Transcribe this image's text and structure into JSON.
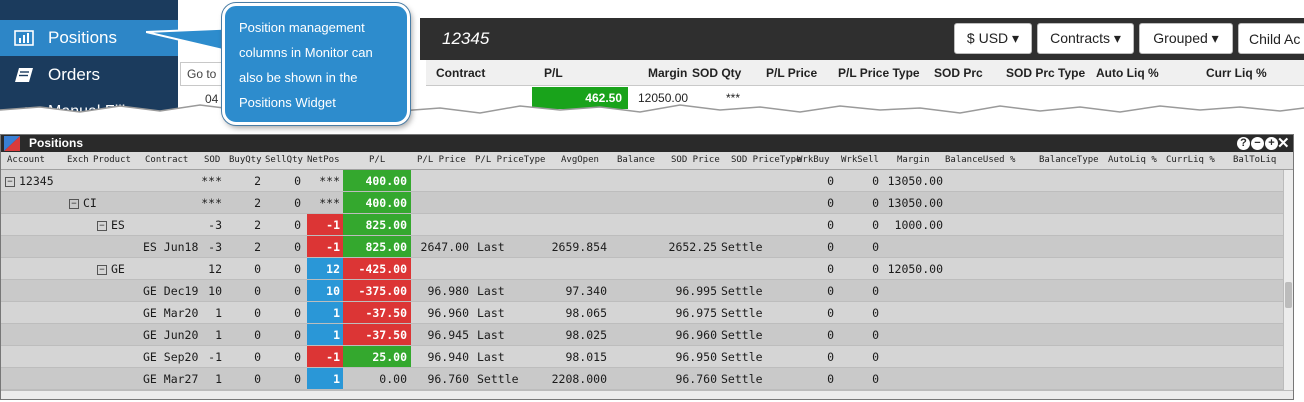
{
  "monitor": {
    "sidebar": {
      "items": [
        {
          "label": "Positions",
          "icon": "bar-chart-icon"
        },
        {
          "label": "Orders",
          "icon": "orders-icon"
        },
        {
          "label": "Manual Fills",
          "icon": "manual-fills-icon"
        }
      ]
    },
    "collapse_glyph": "«",
    "goto_placeholder": "Go to",
    "small_value": "04",
    "account_title": "12345",
    "buttons": [
      "$ USD ▾",
      "Contracts ▾",
      "Grouped ▾",
      "Child Ac"
    ],
    "grid_headers": [
      "Contract",
      "P/L",
      "Margin",
      "SOD Qty",
      "P/L Price",
      "P/L Price Type",
      "SOD Prc",
      "SOD Prc Type",
      "Auto Liq %",
      "Curr Liq %"
    ],
    "grid_row": {
      "pl": "462.50",
      "margin": "12050.00",
      "sod_qty": "***"
    }
  },
  "callout": {
    "text": "Position management columns in Monitor can also be shown in the Positions Widget"
  },
  "widget": {
    "title": "Positions",
    "controls": [
      "?",
      "−",
      "+",
      "✕"
    ],
    "columns": [
      "Account",
      "Exch",
      "Product",
      "Contract",
      "SOD",
      "BuyQty",
      "SellQty",
      "NetPos",
      "P/L",
      "P/L Price",
      "P/L PriceType",
      "AvgOpen",
      "Balance",
      "SOD Price",
      "SOD PriceType",
      "WrkBuy",
      "WrkSell",
      "Margin",
      "BalanceUsed %",
      "BalanceType",
      "AutoLiq %",
      "CurrLiq %",
      "BalToLiq"
    ],
    "colors": {
      "positive": "#34a82e",
      "negative": "#dc3535",
      "long": "#2a97d7"
    },
    "rows": [
      {
        "level": 0,
        "tree": "12345",
        "contract": "",
        "sod": "***",
        "buy": "2",
        "sell": "0",
        "net": "***",
        "net_color": "",
        "pl": "400.00",
        "pl_color": "positive",
        "pl_price": "",
        "pl_type": "",
        "avg_open": "",
        "sod_price": "",
        "sod_type": "",
        "wrk_buy": "0",
        "wrk_sell": "0",
        "margin": "13050.00"
      },
      {
        "level": 1,
        "tree": "CI",
        "contract": "",
        "sod": "***",
        "buy": "2",
        "sell": "0",
        "net": "***",
        "net_color": "",
        "pl": "400.00",
        "pl_color": "positive",
        "pl_price": "",
        "pl_type": "",
        "avg_open": "",
        "sod_price": "",
        "sod_type": "",
        "wrk_buy": "0",
        "wrk_sell": "0",
        "margin": "13050.00"
      },
      {
        "level": 2,
        "tree": "ES",
        "contract": "",
        "sod": "-3",
        "buy": "2",
        "sell": "0",
        "net": "-1",
        "net_color": "negative",
        "pl": "825.00",
        "pl_color": "positive",
        "pl_price": "",
        "pl_type": "",
        "avg_open": "",
        "sod_price": "",
        "sod_type": "",
        "wrk_buy": "0",
        "wrk_sell": "0",
        "margin": "1000.00"
      },
      {
        "level": 3,
        "tree": "",
        "contract": "ES Jun18",
        "sod": "-3",
        "buy": "2",
        "sell": "0",
        "net": "-1",
        "net_color": "negative",
        "pl": "825.00",
        "pl_color": "positive",
        "pl_price": "2647.00",
        "pl_type": "Last",
        "avg_open": "2659.854",
        "sod_price": "2652.25",
        "sod_type": "Settle",
        "wrk_buy": "0",
        "wrk_sell": "0",
        "margin": ""
      },
      {
        "level": 2,
        "tree": "GE",
        "contract": "",
        "sod": "12",
        "buy": "0",
        "sell": "0",
        "net": "12",
        "net_color": "long",
        "pl": "-425.00",
        "pl_color": "negative",
        "pl_price": "",
        "pl_type": "",
        "avg_open": "",
        "sod_price": "",
        "sod_type": "",
        "wrk_buy": "0",
        "wrk_sell": "0",
        "margin": "12050.00"
      },
      {
        "level": 3,
        "tree": "",
        "contract": "GE Dec19",
        "sod": "10",
        "buy": "0",
        "sell": "0",
        "net": "10",
        "net_color": "long",
        "pl": "-375.00",
        "pl_color": "negative",
        "pl_price": "96.980",
        "pl_type": "Last",
        "avg_open": "97.340",
        "sod_price": "96.995",
        "sod_type": "Settle",
        "wrk_buy": "0",
        "wrk_sell": "0",
        "margin": ""
      },
      {
        "level": 3,
        "tree": "",
        "contract": "GE Mar20",
        "sod": "1",
        "buy": "0",
        "sell": "0",
        "net": "1",
        "net_color": "long",
        "pl": "-37.50",
        "pl_color": "negative",
        "pl_price": "96.960",
        "pl_type": "Last",
        "avg_open": "98.065",
        "sod_price": "96.975",
        "sod_type": "Settle",
        "wrk_buy": "0",
        "wrk_sell": "0",
        "margin": ""
      },
      {
        "level": 3,
        "tree": "",
        "contract": "GE Jun20",
        "sod": "1",
        "buy": "0",
        "sell": "0",
        "net": "1",
        "net_color": "long",
        "pl": "-37.50",
        "pl_color": "negative",
        "pl_price": "96.945",
        "pl_type": "Last",
        "avg_open": "98.025",
        "sod_price": "96.960",
        "sod_type": "Settle",
        "wrk_buy": "0",
        "wrk_sell": "0",
        "margin": ""
      },
      {
        "level": 3,
        "tree": "",
        "contract": "GE Sep20",
        "sod": "-1",
        "buy": "0",
        "sell": "0",
        "net": "-1",
        "net_color": "negative",
        "pl": "25.00",
        "pl_color": "positive",
        "pl_price": "96.940",
        "pl_type": "Last",
        "avg_open": "98.015",
        "sod_price": "96.950",
        "sod_type": "Settle",
        "wrk_buy": "0",
        "wrk_sell": "0",
        "margin": ""
      },
      {
        "level": 3,
        "tree": "",
        "contract": "GE Mar27",
        "sod": "1",
        "buy": "0",
        "sell": "0",
        "net": "1",
        "net_color": "long",
        "pl": "0.00",
        "pl_color": "",
        "pl_price": "96.760",
        "pl_type": "Settle",
        "avg_open": "2208.000",
        "sod_price": "96.760",
        "sod_type": "Settle",
        "wrk_buy": "0",
        "wrk_sell": "0",
        "margin": ""
      }
    ]
  }
}
